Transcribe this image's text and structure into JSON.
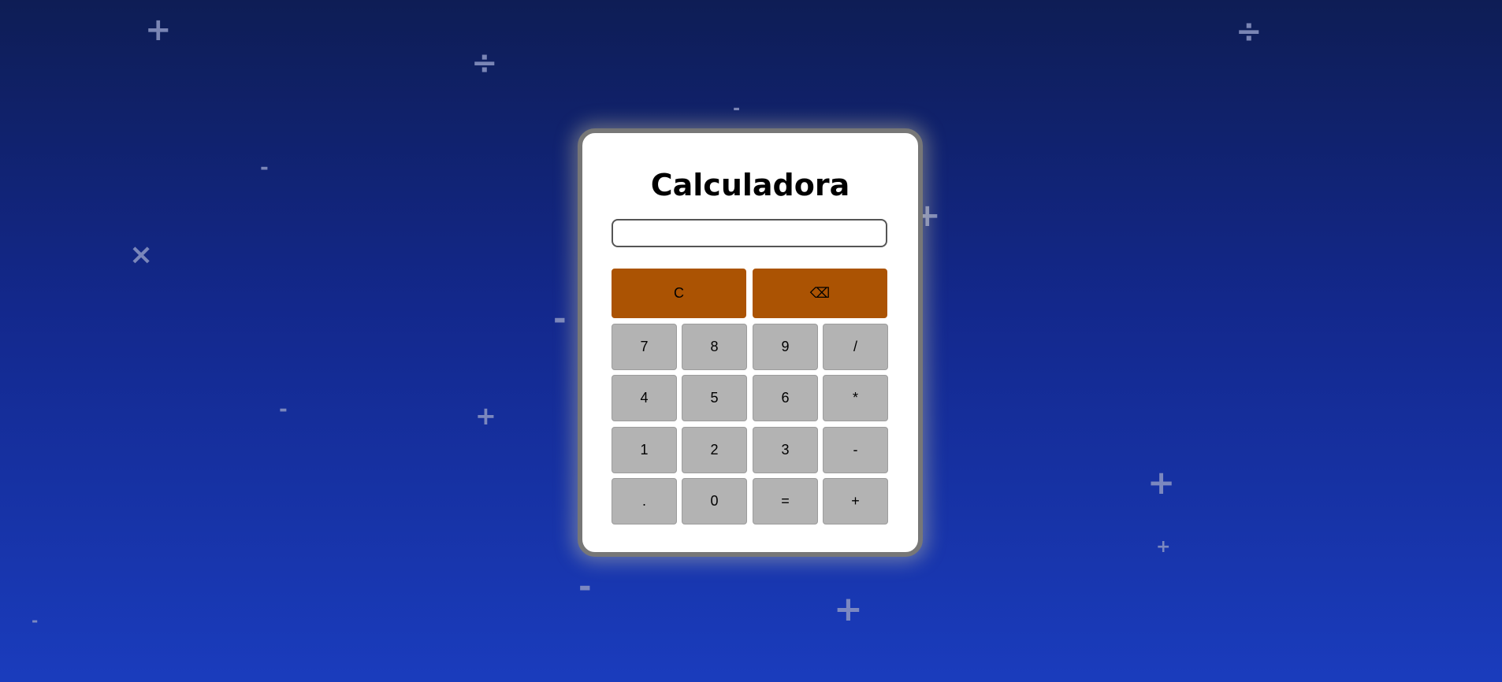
{
  "calculator": {
    "title": "Calculadora",
    "display_value": "",
    "display_placeholder": "",
    "clear_label": "C",
    "backspace_label": "⌫",
    "keys": [
      [
        "7",
        "8",
        "9",
        "/"
      ],
      [
        "4",
        "5",
        "6",
        "*"
      ],
      [
        "1",
        "2",
        "3",
        "-"
      ],
      [
        ".",
        "0",
        "=",
        "+"
      ]
    ]
  },
  "colors": {
    "background_top": "#0e1d55",
    "background_bottom": "#1a3cbd",
    "action_buttons": "#ab5303",
    "key_buttons": "#b3b3b3",
    "card_border": "#777777",
    "decor_symbols": "#8d97c4"
  },
  "background_symbols": [
    "+",
    "÷",
    "-",
    "-",
    "×",
    "-",
    "+",
    "÷",
    "+",
    "-",
    "-",
    "+",
    "+",
    "-",
    "+",
    "-"
  ]
}
